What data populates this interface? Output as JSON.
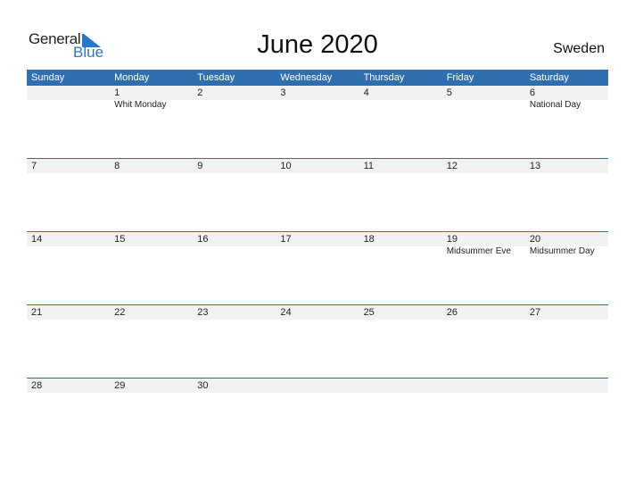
{
  "logo": {
    "word1": "General",
    "word2": "Blue"
  },
  "title": "June 2020",
  "country": "Sweden",
  "colors": {
    "accent": "#2f6fb0",
    "logo_blue": "#2a77c5",
    "band": "#f2f2f2"
  },
  "weekdays": [
    "Sunday",
    "Monday",
    "Tuesday",
    "Wednesday",
    "Thursday",
    "Friday",
    "Saturday"
  ],
  "weeks": [
    [
      {
        "day": ""
      },
      {
        "day": "1",
        "holiday": "Whit Monday"
      },
      {
        "day": "2"
      },
      {
        "day": "3"
      },
      {
        "day": "4"
      },
      {
        "day": "5"
      },
      {
        "day": "6",
        "holiday": "National Day"
      }
    ],
    [
      {
        "day": "7"
      },
      {
        "day": "8"
      },
      {
        "day": "9"
      },
      {
        "day": "10"
      },
      {
        "day": "11"
      },
      {
        "day": "12"
      },
      {
        "day": "13"
      }
    ],
    [
      {
        "day": "14"
      },
      {
        "day": "15"
      },
      {
        "day": "16"
      },
      {
        "day": "17"
      },
      {
        "day": "18"
      },
      {
        "day": "19",
        "holiday": "Midsummer Eve"
      },
      {
        "day": "20",
        "holiday": "Midsummer Day"
      }
    ],
    [
      {
        "day": "21"
      },
      {
        "day": "22"
      },
      {
        "day": "23"
      },
      {
        "day": "24"
      },
      {
        "day": "25"
      },
      {
        "day": "26"
      },
      {
        "day": "27"
      }
    ],
    [
      {
        "day": "28"
      },
      {
        "day": "29"
      },
      {
        "day": "30"
      },
      {
        "day": ""
      },
      {
        "day": ""
      },
      {
        "day": ""
      },
      {
        "day": ""
      }
    ]
  ]
}
